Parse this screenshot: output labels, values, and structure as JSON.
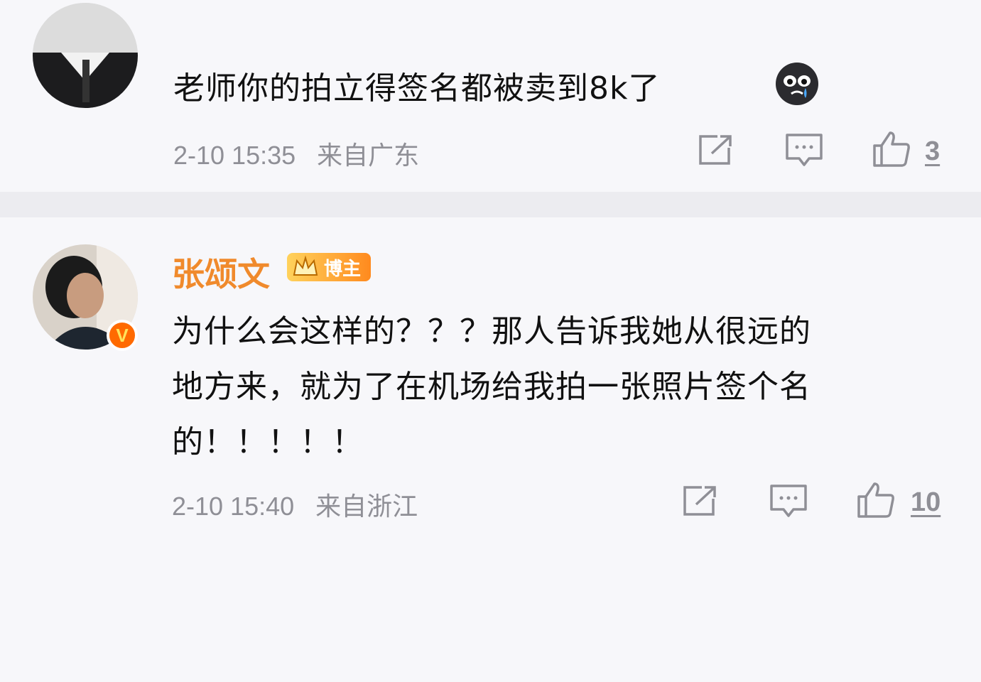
{
  "comments": [
    {
      "text": "老师你的拍立得签名都被卖到8k了",
      "emoji_icon": "crying-face-icon",
      "date": "2-10 15:35",
      "location": "来自广东",
      "likes": "3"
    },
    {
      "author": "张颂文",
      "badge": "博主",
      "verified_mark": "V",
      "text_lines": [
        "为什么会这样的？？？那人告诉我她从很远的",
        "地方来，就为了在机场给我拍一张照片签个名",
        "的！！！！！"
      ],
      "date": "2-10 15:40",
      "location": "来自浙江",
      "likes": "10"
    }
  ],
  "colors": {
    "background": "#f7f7fa",
    "divider": "#ececf0",
    "author_name": "#f08a2c",
    "meta_text": "#8f8f96",
    "body_text": "#111111"
  }
}
